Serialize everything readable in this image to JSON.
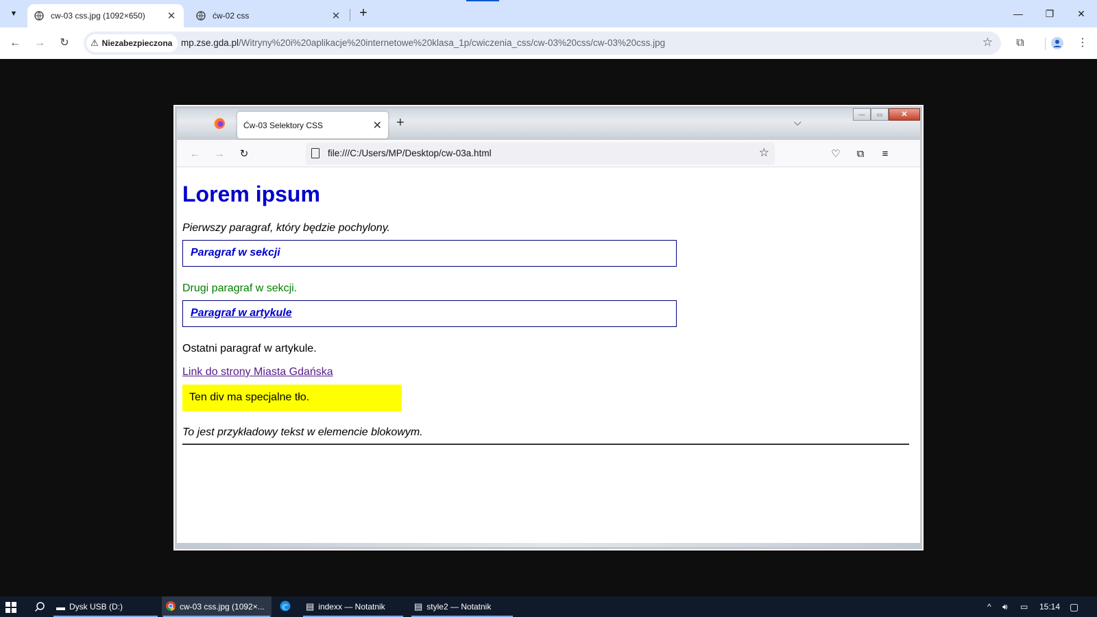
{
  "chrome": {
    "tabs": [
      {
        "title": "cw-03 css.jpg (1092×650)",
        "active": true
      },
      {
        "title": "ćw-02 css",
        "active": false
      }
    ],
    "security_label": "Niezabezpieczona",
    "url_host": "mp.zse.gda.pl",
    "url_path": "/Witryny%20i%20aplikacje%20internetowe%20klasa_1p/cwiczenia_css/cw-03%20css/cw-03%20css.jpg",
    "accent": "#d3e3fd"
  },
  "firefox": {
    "tab_title": "Ćw-03 Selektory CSS",
    "url": "file:///C:/Users/MP/Desktop/cw-03a.html"
  },
  "page": {
    "heading": "Lorem ipsum",
    "p1": "Pierwszy paragraf, który będzie pochylony.",
    "section_p": "Paragraf w sekcji",
    "section_p2": "Drugi paragraf w sekcji.",
    "article_p": "Paragraf w artykule",
    "article_last": "Ostatni paragraf w artykule.",
    "link": "Link do strony Miasta Gdańska",
    "special_div": "Ten div ma specjalne tło.",
    "block_text": "To jest przykładowy tekst w elemencie blokowym.",
    "colors": {
      "heading": "#0000cc",
      "green": "#008000",
      "yellow": "#ffff00",
      "link": "#551a8b"
    }
  },
  "taskbar": {
    "items": [
      {
        "label": "Dysk USB (D:)",
        "icon": "usb-drive-icon"
      },
      {
        "label": "cw-03 css.jpg (1092×...",
        "icon": "chrome-icon"
      },
      {
        "label": "",
        "icon": "edge-icon"
      },
      {
        "label": "indexx — Notatnik",
        "icon": "notepad-icon"
      },
      {
        "label": "style2 — Notatnik",
        "icon": "notepad-icon"
      }
    ],
    "time": "15:14"
  }
}
